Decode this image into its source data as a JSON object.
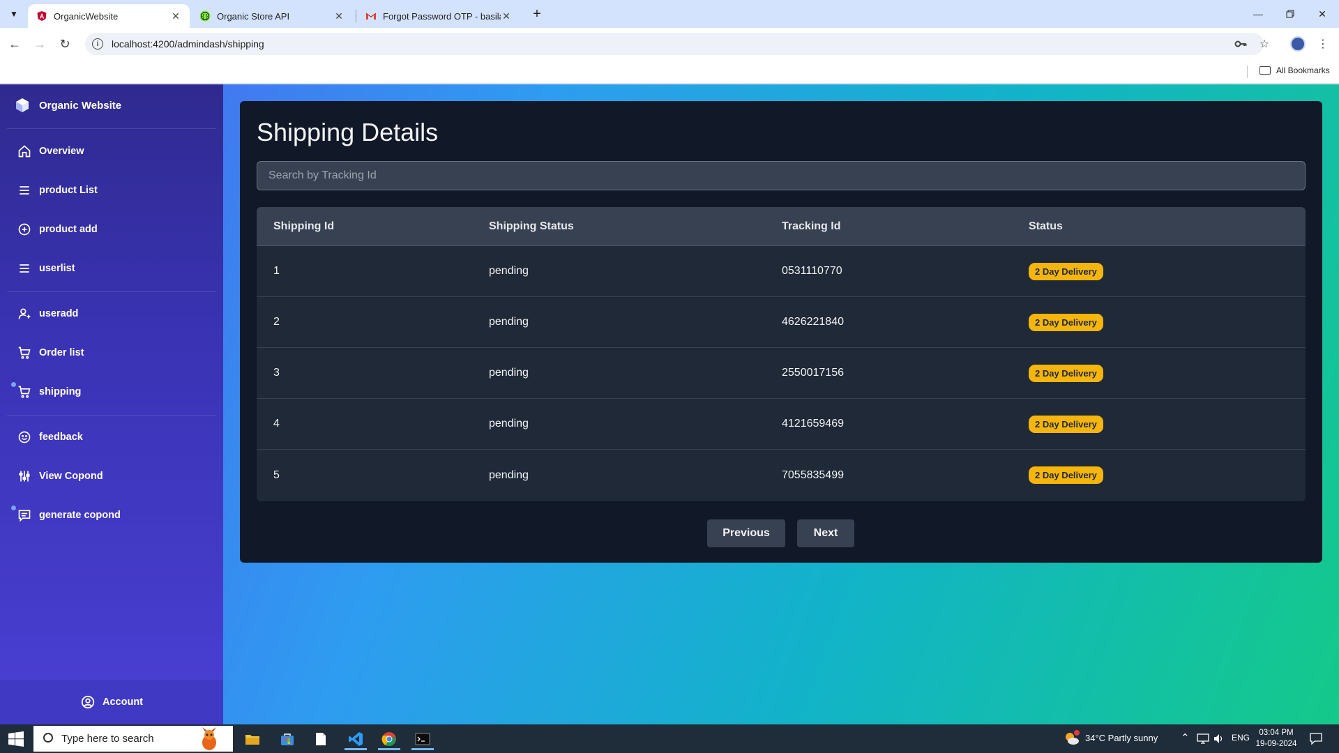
{
  "browser": {
    "tabs": [
      {
        "title": "OrganicWebsite",
        "active": true
      },
      {
        "title": "Organic Store API",
        "active": false
      },
      {
        "title": "Forgot Password OTP - basilaha",
        "active": false
      }
    ],
    "url": "localhost:4200/admindash/shipping",
    "bookmarks_label": "All Bookmarks"
  },
  "sidebar": {
    "brand": "Organic Website",
    "items": [
      {
        "label": "Overview",
        "icon": "home-icon"
      },
      {
        "label": "product List",
        "icon": "list-icon"
      },
      {
        "label": "product add",
        "icon": "plus-circle-icon"
      },
      {
        "label": "userlist",
        "icon": "list-icon"
      },
      {
        "label": "useradd",
        "icon": "user-plus-icon"
      },
      {
        "label": "Order list",
        "icon": "cart-icon"
      },
      {
        "label": "shipping",
        "icon": "cart-icon"
      },
      {
        "label": "feedback",
        "icon": "smile-icon"
      },
      {
        "label": "View Copond",
        "icon": "sliders-icon"
      },
      {
        "label": "generate copond",
        "icon": "message-icon"
      }
    ],
    "account_label": "Account"
  },
  "main": {
    "title": "Shipping Details",
    "search_placeholder": "Search by Tracking Id",
    "columns": [
      "Shipping Id",
      "Shipping Status",
      "Tracking Id",
      "Status"
    ],
    "rows": [
      {
        "id": "1",
        "status": "pending",
        "tracking": "0531110770",
        "badge": "2 Day Delivery"
      },
      {
        "id": "2",
        "status": "pending",
        "tracking": "4626221840",
        "badge": "2 Day Delivery"
      },
      {
        "id": "3",
        "status": "pending",
        "tracking": "2550017156",
        "badge": "2 Day Delivery"
      },
      {
        "id": "4",
        "status": "pending",
        "tracking": "4121659469",
        "badge": "2 Day Delivery"
      },
      {
        "id": "5",
        "status": "pending",
        "tracking": "7055835499",
        "badge": "2 Day Delivery"
      }
    ],
    "prev_label": "Previous",
    "next_label": "Next",
    "badge_color": "#f5b50a"
  },
  "taskbar": {
    "search_placeholder": "Type here to search",
    "weather": "34°C  Partly sunny",
    "language": "ENG",
    "time": "03:04 PM",
    "date": "19-09-2024"
  }
}
